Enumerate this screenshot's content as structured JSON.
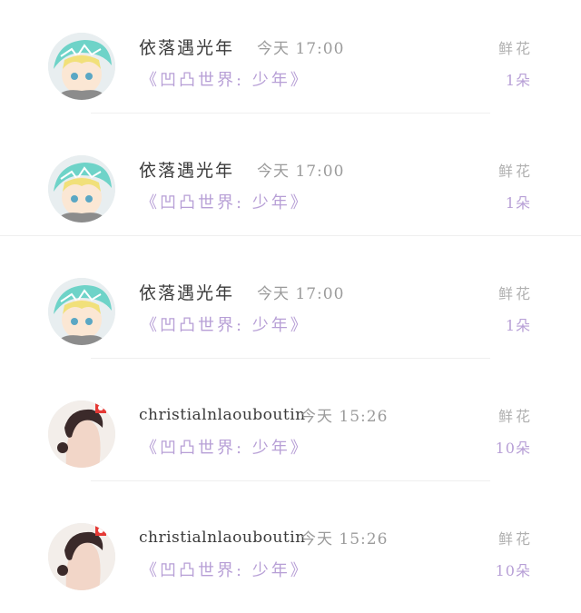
{
  "items": [
    {
      "name": "依落遇光年",
      "time": "今天 17:00",
      "book": "《凹凸世界: 少年》",
      "gift": "鲜花",
      "count": "1朵",
      "avatar": "anime-avatar"
    },
    {
      "name": "依落遇光年",
      "time": "今天 17:00",
      "book": "《凹凸世界: 少年》",
      "gift": "鲜花",
      "count": "1朵",
      "avatar": "anime-avatar"
    },
    {
      "name": "依落遇光年",
      "time": "今天 17:00",
      "book": "《凹凸世界: 少年》",
      "gift": "鲜花",
      "count": "1朵",
      "avatar": "anime-avatar"
    },
    {
      "name": "christialnlaouboutin",
      "time": "今天 15:26",
      "book": "《凹凸世界: 少年》",
      "gift": "鲜花",
      "count": "10朵",
      "avatar": "photo-avatar"
    },
    {
      "name": "christialnlaouboutin",
      "time": "今天 15:26",
      "book": "《凹凸世界: 少年》",
      "gift": "鲜花",
      "count": "10朵",
      "avatar": "photo-avatar"
    }
  ],
  "colors": {
    "accent": "#b79fd6",
    "muted": "#9b9b9b",
    "text": "#3a3a3a"
  }
}
